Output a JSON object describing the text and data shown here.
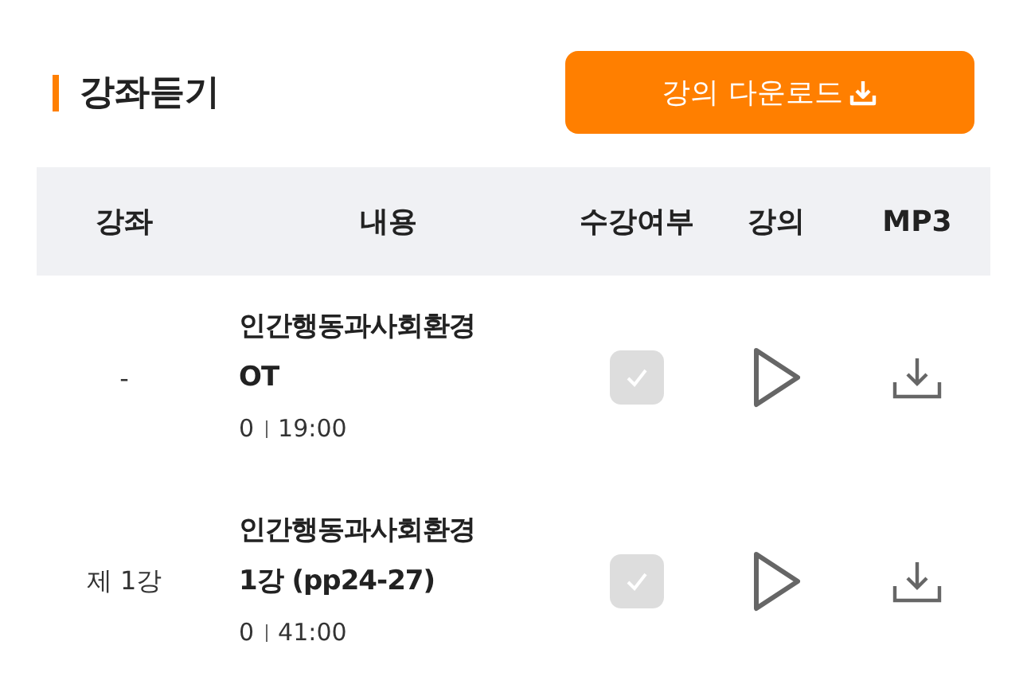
{
  "section": {
    "title": "강좌듣기",
    "download_button": "강의 다운로드"
  },
  "table": {
    "columns": [
      "강좌",
      "내용",
      "수강여부",
      "강의",
      "MP3"
    ],
    "rows": [
      {
        "lecture": "-",
        "title": "인간행동과사회환경",
        "subtitle": "OT",
        "count": "0",
        "duration": "19:00",
        "checked": true,
        "disabled": true
      },
      {
        "lecture": "제 1강",
        "title": "인간행동과사회환경",
        "subtitle": "1강 (pp24-27)",
        "count": "0",
        "duration": "41:00",
        "checked": true,
        "disabled": true
      }
    ]
  }
}
